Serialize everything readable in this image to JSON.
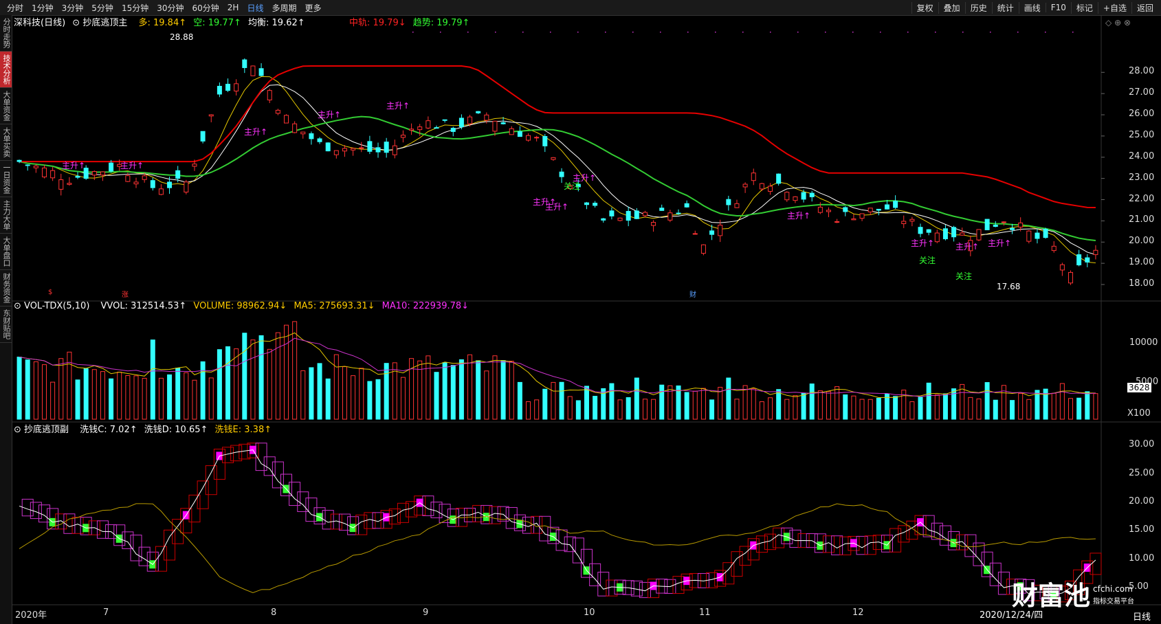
{
  "toolbar": {
    "tabs": [
      "分时",
      "1分钟",
      "3分钟",
      "5分钟",
      "15分钟",
      "30分钟",
      "60分钟",
      "2H",
      "日线",
      "多周期",
      "更多"
    ],
    "active_tab": "日线",
    "right": [
      "复权",
      "叠加",
      "历史",
      "统计",
      "画线",
      "F10",
      "标记",
      "+自选",
      "返回"
    ]
  },
  "sidebar": [
    "分时走势",
    "技术分析",
    "大单资金",
    "大单买卖",
    "一日资金",
    "主力大单",
    "大单盘口",
    "财务资金",
    "东财贴吧"
  ],
  "main_legend": {
    "stock": "深科技(日线)",
    "indicator": "抄底逃顶主",
    "duo": "多: 19.84↑",
    "kong": "空: 19.77↑",
    "junheng": "均衡: 19.62↑",
    "zhonggui": "中轨: 19.79↓",
    "qushi": "趋势: 19.79↑"
  },
  "price_axis": [
    "28.00",
    "27.00",
    "26.00",
    "25.00",
    "24.00",
    "23.00",
    "22.00",
    "21.00",
    "20.00",
    "19.00",
    "18.00"
  ],
  "high_label": "28.88",
  "low_label": "17.68",
  "signals": {
    "up": "主升↑",
    "attn": "关注"
  },
  "event_marks": [
    "$",
    "涨",
    "财"
  ],
  "vol_legend": {
    "title": "VOL-TDX(5,10)",
    "vvol": "VVOL: 312514.53↑",
    "volume": "VOLUME: 98962.94↓",
    "ma5": "MA5: 275693.31↓",
    "ma10": "MA10: 222939.78↓"
  },
  "vol_axis": [
    "10000",
    "5000"
  ],
  "vol_badge": "3628",
  "vol_unit": "X100",
  "sub_legend": {
    "title": "抄底逃顶副",
    "c": "洗钱C: 7.02↑",
    "d": "洗钱D: 10.65↑",
    "e": "洗钱E: 3.38↑"
  },
  "sub_axis": [
    "30.00",
    "25.00",
    "20.00",
    "15.00",
    "10.00",
    "5.00"
  ],
  "dates": [
    "2020年",
    "7",
    "8",
    "9",
    "10",
    "11",
    "12",
    "2020/12/24/四"
  ],
  "period_label": "日线",
  "watermark": {
    "brand": "财富池",
    "site": "cfchi.com",
    "slogan": "指标交易平台"
  },
  "colors": {
    "up": "#ff3333",
    "down": "#33ffff",
    "ma_white": "#ffffff",
    "ma_yellow": "#e6c800",
    "ma_green": "#33cc33",
    "ma_red": "#e60000",
    "purple": "#cc33cc",
    "magenta": "#ff00ff"
  }
}
